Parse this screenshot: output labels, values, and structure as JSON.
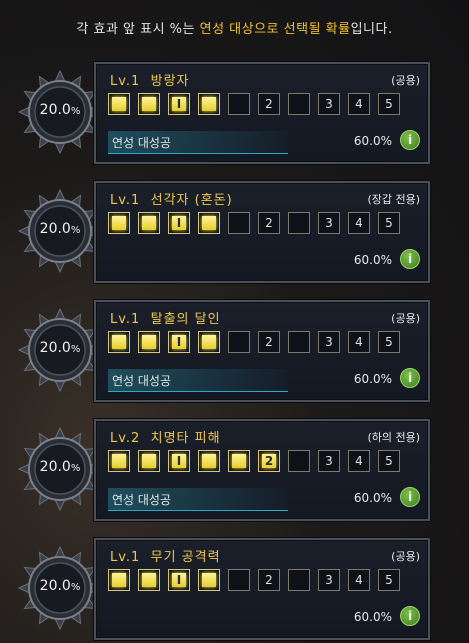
{
  "header": {
    "prefix": "각 효과 앞 표시 %는 ",
    "highlight": "연성 대상으로 선택될 확률",
    "suffix": "입니다."
  },
  "cards": [
    {
      "percent": "20.0",
      "percent_unit": "%",
      "level": "Lv.1",
      "name": "방랑자",
      "tag": "(공용)",
      "success": "연성 대성공",
      "probability": "60.0%",
      "boxes": [
        "on",
        "on",
        "I",
        "on",
        "",
        "2",
        "",
        "3",
        "4",
        "5"
      ]
    },
    {
      "percent": "20.0",
      "percent_unit": "%",
      "level": "Lv.1",
      "name": "선각자 (혼돈)",
      "tag": "(장갑 전용)",
      "success": "",
      "probability": "60.0%",
      "boxes": [
        "on",
        "on",
        "I",
        "on",
        "",
        "2",
        "",
        "3",
        "4",
        "5"
      ]
    },
    {
      "percent": "20.0",
      "percent_unit": "%",
      "level": "Lv.1",
      "name": "탈출의 달인",
      "tag": "(공용)",
      "success": "연성 대성공",
      "probability": "60.0%",
      "boxes": [
        "on",
        "on",
        "I",
        "on",
        "",
        "2",
        "",
        "3",
        "4",
        "5"
      ]
    },
    {
      "percent": "20.0",
      "percent_unit": "%",
      "level": "Lv.2",
      "name": "치명타 피해",
      "tag": "(하의 전용)",
      "success": "연성 대성공",
      "probability": "60.0%",
      "boxes": [
        "on",
        "on",
        "I",
        "on",
        "on",
        "2",
        "",
        "3",
        "4",
        "5"
      ]
    },
    {
      "percent": "20.0",
      "percent_unit": "%",
      "level": "Lv.1",
      "name": "무기 공격력",
      "tag": "(공용)",
      "success": "",
      "probability": "60.0%",
      "boxes": [
        "on",
        "on",
        "I",
        "on",
        "",
        "2",
        "",
        "3",
        "4",
        "5"
      ]
    }
  ],
  "icons": {
    "info": "info-icon",
    "medal": "medal-frame-icon"
  },
  "colors": {
    "gold": "#f2c230",
    "box_on": "#f0df5a",
    "success_bar": "#2aa8c8",
    "info_green": "#5a9e32"
  }
}
